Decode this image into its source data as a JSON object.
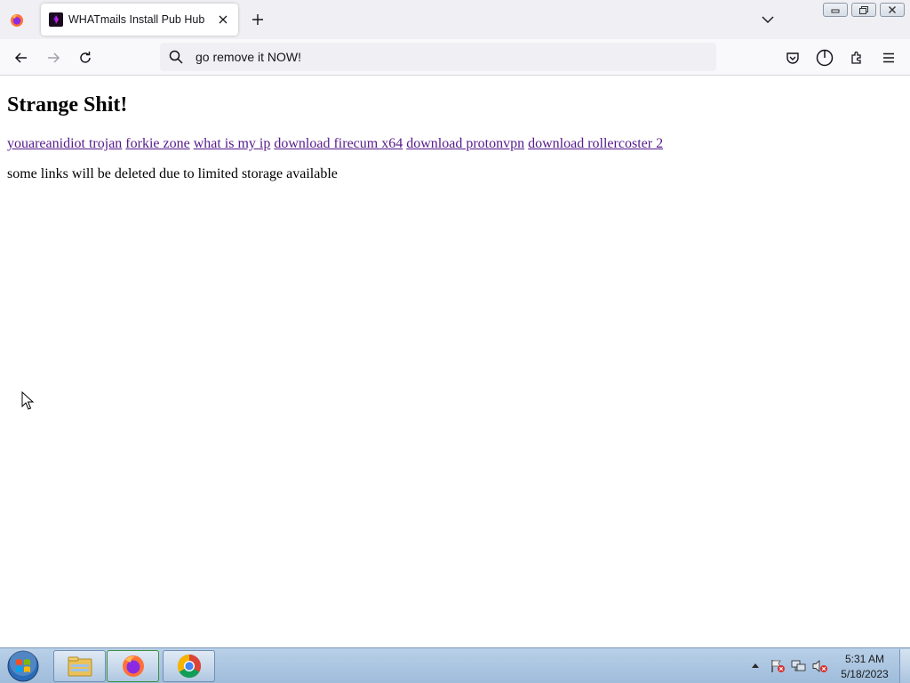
{
  "browser": {
    "tab": {
      "title": "WHATmails Install Pub Hub"
    },
    "urlbar": {
      "text": "go remove it NOW!"
    }
  },
  "page": {
    "title": "Strange Shit!",
    "links": [
      "youareanidiot trojan",
      "forkie zone",
      "what is my ip",
      "download firecum x64",
      "download protonvpn",
      "download rollercoster 2"
    ],
    "notice": "some links will be deleted due to limited storage available",
    "link_color": "#551a8b"
  },
  "taskbar": {
    "clock": {
      "time": "5:31 AM",
      "date": "5/18/2023"
    },
    "pinned": [
      "file-explorer-icon",
      "firefox-icon",
      "chrome-icon"
    ]
  }
}
